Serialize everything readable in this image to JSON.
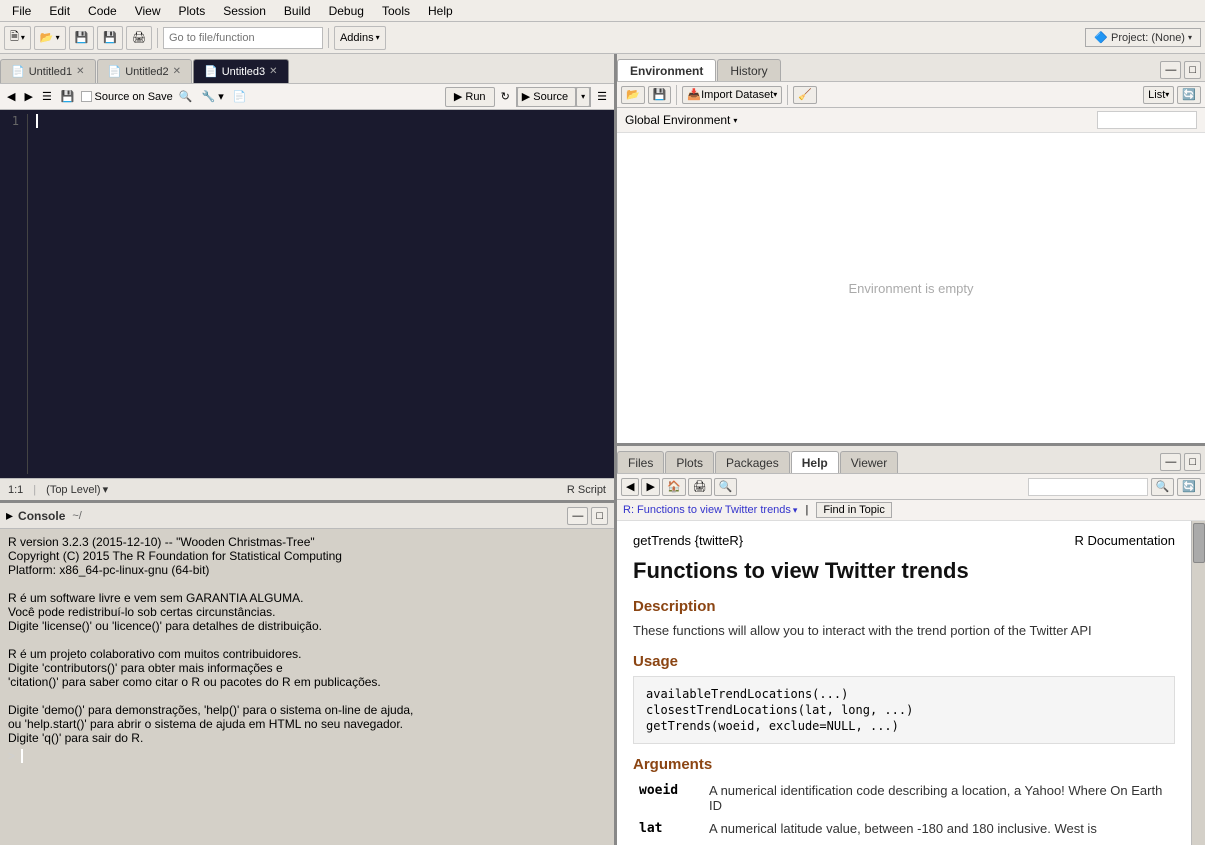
{
  "menubar": {
    "items": [
      "File",
      "Edit",
      "Code",
      "View",
      "Plots",
      "Session",
      "Build",
      "Debug",
      "Tools",
      "Help"
    ]
  },
  "toolbar": {
    "new_btn": "🗎",
    "open_btn": "📂",
    "save_btn": "💾",
    "save_all_btn": "💾",
    "print_btn": "🖨",
    "goto_placeholder": "Go to file/function",
    "addins_label": "Addins",
    "project_label": "Project: (None)"
  },
  "editor": {
    "tabs": [
      {
        "label": "Untitled1",
        "active": false
      },
      {
        "label": "Untitled2",
        "active": false
      },
      {
        "label": "Untitled3",
        "active": true
      }
    ],
    "source_on_save": "Source on Save",
    "run_label": "Run",
    "source_label": "Source",
    "status": {
      "position": "1:1",
      "level": "(Top Level)",
      "type": "R Script"
    }
  },
  "console": {
    "title": "Console",
    "path": "~/",
    "lines": [
      "R version 3.2.3 (2015-12-10) -- \"Wooden Christmas-Tree\"",
      "Copyright (C) 2015 The R Foundation for Statistical Computing",
      "Platform: x86_64-pc-linux-gnu (64-bit)",
      "",
      "R é um software livre e vem sem GARANTIA ALGUMA.",
      "Você pode redistribuí-lo sob certas circunstâncias.",
      "Digite 'license()' ou 'licence()' para detalhes de distribuição.",
      "",
      "R é um projeto colaborativo com muitos contribuidores.",
      "Digite 'contributors()' para obter mais informações e",
      "'citation()' para saber como citar o R ou pacotes do R em publicações.",
      "",
      "Digite 'demo()' para demonstrações, 'help()' para o sistema on-line de ajuda,",
      "ou 'help.start()' para abrir o sistema de ajuda em HTML no seu navegador.",
      "Digite 'q()' para sair do R."
    ]
  },
  "environment": {
    "tabs": [
      "Environment",
      "History"
    ],
    "active_tab": "Environment",
    "toolbar": {
      "import_dataset": "Import Dataset",
      "list_btn": "List"
    },
    "global_env": "Global Environment",
    "search_placeholder": "",
    "empty_message": "Environment is empty"
  },
  "help": {
    "tabs": [
      "Files",
      "Plots",
      "Packages",
      "Help",
      "Viewer"
    ],
    "active_tab": "Help",
    "breadcrumb": {
      "link": "R: Functions to view Twitter trends",
      "find_label": "Find in Topic"
    },
    "content": {
      "pkg": "getTrends {twitteR}",
      "rdoc": "R Documentation",
      "title": "Functions to view Twitter trends",
      "description_title": "Description",
      "description_text": "These functions will allow you to interact with the trend portion of the Twitter API",
      "usage_title": "Usage",
      "usage_lines": [
        "availableTrendLocations(...)",
        "closestTrendLocations(lat, long, ...)",
        "getTrends(woeid, exclude=NULL, ...)"
      ],
      "arguments_title": "Arguments",
      "arguments": [
        {
          "name": "woeid",
          "desc": "A numerical identification code describing a location, a Yahoo! Where On Earth ID"
        },
        {
          "name": "lat",
          "desc": "A numerical latitude value, between -180 and 180 inclusive. West is"
        }
      ]
    }
  }
}
